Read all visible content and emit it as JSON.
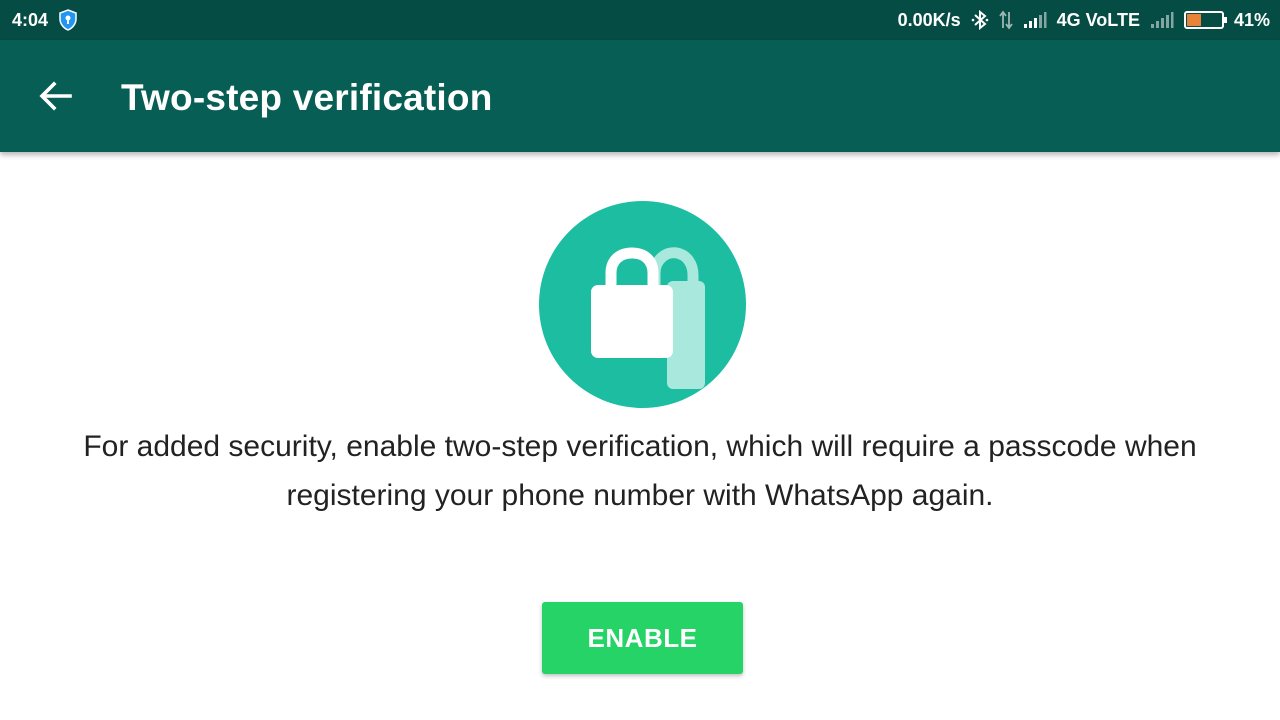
{
  "status_bar": {
    "time": "4:04",
    "network_speed": "0.00K/s",
    "network_type": "4G VoLTE",
    "battery_percent": "41%",
    "battery_level": 0.41,
    "icons": [
      "shield-icon",
      "bluetooth-icon",
      "data-arrows-icon",
      "signal-icon",
      "signal-icon",
      "battery-icon"
    ]
  },
  "header": {
    "title": "Two-step verification",
    "back_icon": "arrow-left-icon"
  },
  "main": {
    "illustration_icon": "padlock-icon",
    "description": "For added security, enable two-step verification, which will require a passcode when registering your phone number with WhatsApp again.",
    "enable_label": "ENABLE"
  },
  "colors": {
    "status_bar": "#054d44",
    "app_bar": "#075e54",
    "accent_circle": "#1cbda1",
    "button": "#25d366",
    "battery_fill": "#e8833a"
  }
}
